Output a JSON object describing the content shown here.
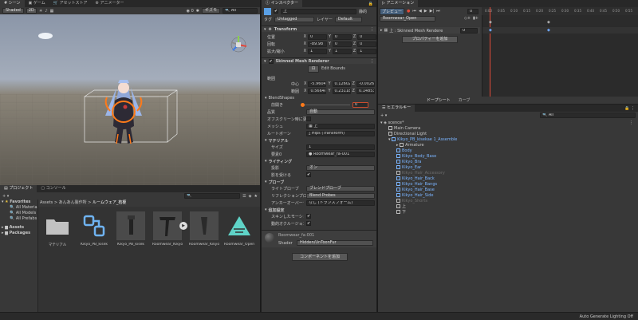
{
  "scene_tabs": [
    "シーン",
    "ゲーム",
    "アセットストア",
    "アニメーター"
  ],
  "scene_toolbar": {
    "shading": "Shaded",
    "mode_2d": "2D",
    "gizmos": "ギズモ",
    "search_prefix": "All"
  },
  "project": {
    "tabs": [
      "プロジェクト",
      "コンソール"
    ],
    "favorites_label": "Favorites",
    "favorites": [
      "All Materia",
      "All Models",
      "All Prefabs"
    ],
    "roots": [
      "Assets",
      "Packages"
    ],
    "breadcrumb": [
      "Assets",
      "あんあん製作所",
      "ルームウェア_桔梗"
    ],
    "assets": [
      "マテリアル",
      "Kikyo_PB_kisek",
      "Kikyo_PB_kisek",
      "Roomwear_Kikyo",
      "Roomwear_Kikyo",
      "Roomwear_Open"
    ]
  },
  "inspector": {
    "tab": "インスペクター",
    "name": "上",
    "static_label": "静的",
    "tag_label": "タグ",
    "tag_value": "Untagged",
    "layer_label": "レイヤー",
    "layer_value": "Default",
    "transform": {
      "title": "Transform",
      "rows": [
        {
          "label": "位置",
          "x": "0",
          "y": "0",
          "z": "0"
        },
        {
          "label": "回転",
          "x": "-89.98",
          "y": "0",
          "z": "0"
        },
        {
          "label": "拡大/縮小",
          "x": "1",
          "y": "1",
          "z": "1"
        }
      ]
    },
    "smr": {
      "title": "Skinned Mesh Renderer",
      "edit_bounds": "Edit Bounds",
      "bounds_label": "範囲",
      "center_label": "中心",
      "center": {
        "x": "-5.9604",
        "y": "0.12602",
        "z": "-0.0026"
      },
      "extent_label": "範囲",
      "extent": {
        "x": "0.56648",
        "y": "0.23118",
        "z": "0.14853"
      },
      "blendshapes": "BlendShapes",
      "open_label": "前開き",
      "open_value": "0",
      "quality_label": "品質",
      "quality_value": "自動",
      "offscreen_label": "オフスクリーン時に更新",
      "mesh_label": "メッシュ",
      "mesh_value": "上",
      "root_label": "ルートボーン",
      "root_value": "Hips (Transform)"
    },
    "materials": {
      "title": "マテリアル",
      "size_label": "サイズ",
      "size_value": "1",
      "elem_label": "要素0",
      "elem_value": "Roomwear_fa-001"
    },
    "lighting": {
      "title": "ライティング",
      "cast_label": "投影",
      "cast_value": "オン",
      "receive_label": "影を受ける"
    },
    "probes": {
      "title": "プローブ",
      "light_label": "ライトプローブ",
      "light_value": "ブレンドプローブ",
      "refl_label": "リフレクションプローブ",
      "refl_value": "Blend Probes",
      "anchor_label": "アンカーオーバーライド",
      "anchor_value": "なし (トランスフォーム)"
    },
    "additional": {
      "title": "追加設定",
      "skinned_label": "スキンしたモーション",
      "dynamic_label": "動的オクルージョン"
    },
    "material_block": {
      "name": "Roomwear_fa-001",
      "shader_label": "Shader",
      "shader_value": "Hidden/UnToonFur"
    },
    "add_component": "コンポーネントを追加"
  },
  "animation": {
    "tab": "アニメーション",
    "preview": "プレビュー",
    "frame": "0",
    "clip": "Roomwear_Open",
    "ruler": [
      "0:00",
      "0:05",
      "0:10",
      "0:15",
      "0:20",
      "0:25",
      "0:30",
      "0:35",
      "0:40",
      "0:45",
      "0:50",
      "0:55",
      "1:00"
    ],
    "property": "上 : Skinned Mesh Rendere",
    "property_value": "0",
    "add_property": "プロパティーを追加",
    "footer_tabs": [
      "ドープシート",
      "カーブ"
    ]
  },
  "hierarchy": {
    "tab": "ヒエラルキー",
    "scene": "scence*",
    "items": [
      {
        "label": "Main Camera",
        "indent": 1,
        "color": "normal"
      },
      {
        "label": "Directional Light",
        "indent": 1,
        "color": "normal"
      },
      {
        "label": "Kikyo_PB_kisekae 1_Assemble",
        "indent": 1,
        "color": "blue"
      },
      {
        "label": "Armature",
        "indent": 2,
        "color": "normal"
      },
      {
        "label": "Body",
        "indent": 2,
        "color": "blue"
      },
      {
        "label": "Kikyo_Body_Base",
        "indent": 2,
        "color": "blue"
      },
      {
        "label": "Kikyo_Bra",
        "indent": 2,
        "color": "blue"
      },
      {
        "label": "Kikyo_Ear",
        "indent": 2,
        "color": "blue"
      },
      {
        "label": "Kikyo_Hair_Accessory",
        "indent": 2,
        "color": "grey"
      },
      {
        "label": "Kikyo_Hair_Back",
        "indent": 2,
        "color": "blue"
      },
      {
        "label": "Kikyo_Hair_Bangs",
        "indent": 2,
        "color": "blue"
      },
      {
        "label": "Kikyo_Hair_Base",
        "indent": 2,
        "color": "blue"
      },
      {
        "label": "Kikyo_Hair_Side",
        "indent": 2,
        "color": "blue"
      },
      {
        "label": "Kikyo_Shorts",
        "indent": 2,
        "color": "grey"
      },
      {
        "label": "上",
        "indent": 2,
        "color": "normal"
      },
      {
        "label": "下",
        "indent": 2,
        "color": "normal"
      }
    ]
  },
  "status_bar": "Auto Generate Lighting Off"
}
